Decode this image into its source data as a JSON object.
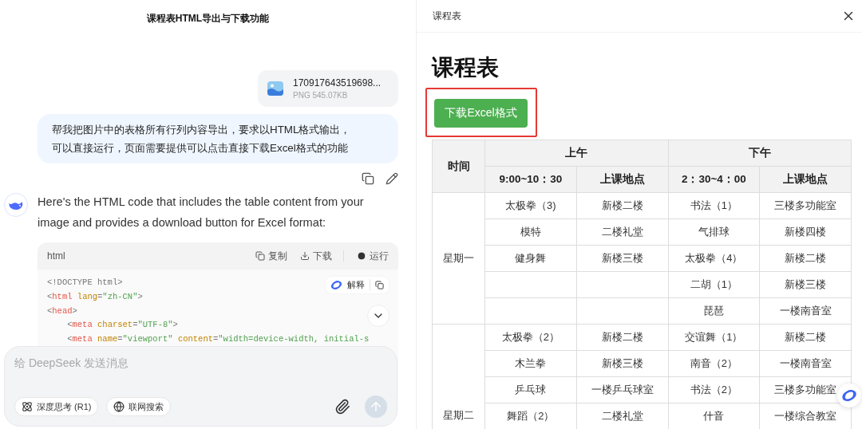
{
  "chat": {
    "title": "课程表HTML导出与下载功能",
    "attachment": {
      "file_name": "170917643519698...",
      "file_meta": "PNG 545.07KB"
    },
    "user_message": "帮我把图片中的表格所有行列内容导出，要求以HTML格式输出，可以直接运行，页面需要提供可以点击直接下载Excel格式的功能",
    "assistant_message": "Here's the HTML code that includes the table content from your image and provides a download button for Excel format:",
    "code_block": {
      "language": "html",
      "actions": [
        {
          "kind": "copy",
          "label": "复制"
        },
        {
          "kind": "download",
          "label": "下载"
        },
        {
          "kind": "run",
          "label": "运行"
        }
      ],
      "explain_label": "解释",
      "lines": [
        {
          "tokens": [
            {
              "kind": "punct",
              "text": "<!DOCTYPE html>"
            }
          ]
        },
        {
          "tokens": [
            {
              "kind": "punct",
              "text": "<"
            },
            {
              "kind": "tag",
              "text": "html"
            },
            {
              "kind": "attr",
              "text": " lang"
            },
            {
              "kind": "punct",
              "text": "="
            },
            {
              "kind": "string",
              "text": "\"zh-CN\""
            },
            {
              "kind": "punct",
              "text": ">"
            }
          ]
        },
        {
          "tokens": [
            {
              "kind": "punct",
              "text": "<"
            },
            {
              "kind": "tag",
              "text": "head"
            },
            {
              "kind": "punct",
              "text": ">"
            }
          ]
        },
        {
          "tokens": [
            {
              "kind": "punct",
              "text": "    <"
            },
            {
              "kind": "tag",
              "text": "meta"
            },
            {
              "kind": "attr",
              "text": " charset"
            },
            {
              "kind": "punct",
              "text": "="
            },
            {
              "kind": "string",
              "text": "\"UTF-8\""
            },
            {
              "kind": "punct",
              "text": ">"
            }
          ]
        },
        {
          "tokens": [
            {
              "kind": "punct",
              "text": "    <"
            },
            {
              "kind": "tag",
              "text": "meta"
            },
            {
              "kind": "attr",
              "text": " name"
            },
            {
              "kind": "punct",
              "text": "="
            },
            {
              "kind": "string",
              "text": "\"viewport\""
            },
            {
              "kind": "attr",
              "text": " content"
            },
            {
              "kind": "punct",
              "text": "="
            },
            {
              "kind": "string",
              "text": "\"width=device-width, initial-s"
            }
          ]
        }
      ]
    },
    "input": {
      "placeholder": "给 DeepSeek 发送消息",
      "toggles": [
        {
          "kind": "deep_think",
          "label": "深度思考 (R1)",
          "selected": false
        },
        {
          "kind": "web_search",
          "label": "联网搜索",
          "selected": false
        }
      ],
      "send_disabled": true
    }
  },
  "preview": {
    "tab_title": "课程表",
    "heading": "课程表",
    "download_button": "下载Excel格式",
    "highlighted": true,
    "table": {
      "time_label": "时间",
      "groups": [
        "上午",
        "下午"
      ],
      "subheaders": [
        "9:00~10：30",
        "上课地点",
        "2：30~4：00",
        "上课地点"
      ],
      "days": [
        {
          "day": "星期一",
          "rows": [
            {
              "am_course": "太极拳（3)",
              "am_place": "新楼二楼",
              "pm_course": "书法（1）",
              "pm_place": "三楼多功能室"
            },
            {
              "am_course": "模特",
              "am_place": "二楼礼堂",
              "pm_course": "气排球",
              "pm_place": "新楼四楼"
            },
            {
              "am_course": "健身舞",
              "am_place": "新楼三楼",
              "pm_course": "太极拳（4）",
              "pm_place": "新楼二楼"
            },
            {
              "pm_course": "二胡（1）",
              "pm_place": "新楼三楼"
            },
            {
              "pm_course": "琵琶",
              "pm_place": "一楼南音室"
            }
          ]
        },
        {
          "day": "星期二",
          "rows": [
            {
              "am_course": "太极拳（2）",
              "am_place": "新楼二楼",
              "pm_course": "交谊舞（1）",
              "pm_place": "新楼二楼"
            },
            {
              "am_course": "木兰拳",
              "am_place": "新楼三楼",
              "pm_course": "南音（2）",
              "pm_place": "一楼南音室"
            },
            {
              "am_course": "乒乓球",
              "am_place": "一楼乒乓球室",
              "pm_course": "书法（2）",
              "pm_place": "三楼多功能室"
            },
            {
              "am_course": "舞蹈（2）",
              "am_place": "二楼礼堂",
              "pm_course": "什音",
              "pm_place": "一楼综合教室"
            }
          ]
        }
      ]
    }
  }
}
